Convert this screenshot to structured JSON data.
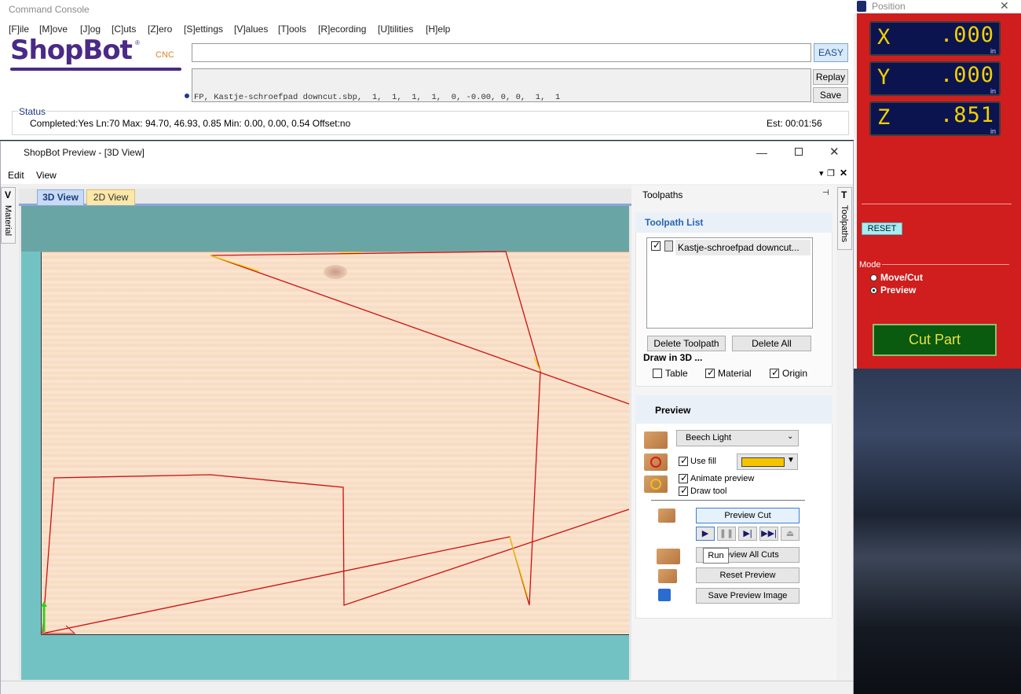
{
  "console": {
    "title": "Command Console",
    "menu": [
      "[F]ile",
      "[M]ove",
      "[J]og",
      "[C]uts",
      "[Z]ero",
      "[S]ettings",
      "[V]alues",
      "[T]ools",
      "[R]ecording",
      "[U]tilities",
      "[H]elp"
    ],
    "logo_text": "ShopBot",
    "logo_sub": "CNC",
    "easy_label": "EASY",
    "command_line": "FP, Kastje-schroefpad downcut.sbp,  1,  1,  1,  1,  0, -0.00, 0, 0,  1,  1",
    "replay_label": "Replay",
    "save_label": "Save",
    "status_label": "Status",
    "status_text": "Completed:Yes Ln:70 Max: 94.70, 46.93, 0.85  Min: 0.00, 0.00, 0.54  Offset:no",
    "est_text": "Est: 00:01:56"
  },
  "position": {
    "title": "Position",
    "close": "✕",
    "axes": [
      {
        "axis": "X",
        "value": ".000",
        "unit": "in"
      },
      {
        "axis": "Y",
        "value": ".000",
        "unit": "in"
      },
      {
        "axis": "Z",
        "value": ".851",
        "unit": "in"
      }
    ],
    "reset_label": "RESET",
    "mode_label": "Mode",
    "mode_options": [
      "Move/Cut",
      "Preview"
    ],
    "mode_selected": "Preview",
    "cut_part_label": "Cut Part"
  },
  "preview": {
    "title": "ShopBot Preview - [3D View]",
    "menu": [
      "Edit",
      "View"
    ],
    "tabs": [
      "3D View",
      "2D View"
    ],
    "active_tab": "3D View",
    "left_tab": "Material",
    "right_tab": "Toolpaths"
  },
  "toolpaths": {
    "header": "Toolpaths",
    "list_heading": "Toolpath List",
    "items": [
      "Kastje-schroefpad downcut..."
    ],
    "delete_label": "Delete Toolpath",
    "delete_all_label": "Delete All",
    "draw_label": "Draw in 3D ...",
    "draw_options": [
      {
        "label": "Table",
        "checked": false
      },
      {
        "label": "Material",
        "checked": true
      },
      {
        "label": "Origin",
        "checked": true
      }
    ]
  },
  "preview_panel": {
    "heading": "Preview",
    "material_select": "Beech Light",
    "use_fill_label": "Use fill",
    "fill_color": "#f5c400",
    "animate_label": "Animate preview",
    "draw_tool_label": "Draw tool",
    "preview_cut_label": "Preview Cut",
    "preview_all_label": "Preview All Cuts",
    "reset_preview_label": "Reset Preview",
    "save_image_label": "Save Preview Image",
    "tooltip": "Run"
  },
  "colors": {
    "panel_red": "#d01d1d",
    "dro_bg": "#0c1450",
    "dro_text": "#f2d000",
    "toolpath": "#cc1111"
  }
}
